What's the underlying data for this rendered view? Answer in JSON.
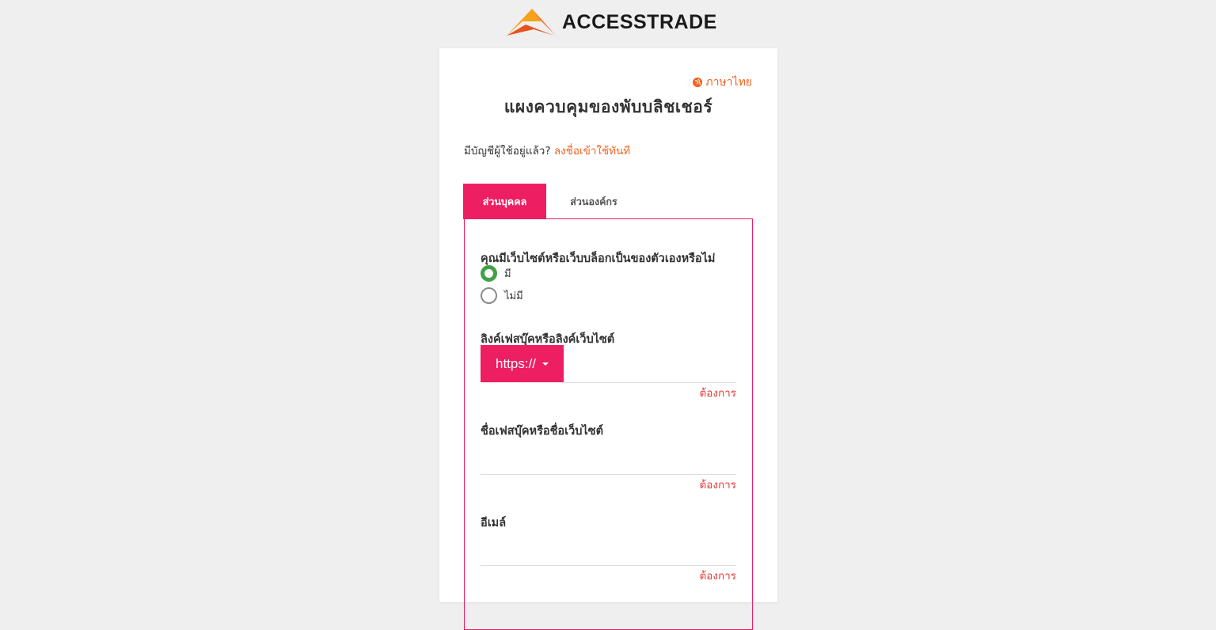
{
  "brand": {
    "name": "ACCESSTRADE",
    "colors": {
      "primary": "#ed1e62",
      "accent": "#f26522",
      "radio": "#43a047"
    }
  },
  "lang": {
    "icon": "globe-icon",
    "label": "ภาษาไทย"
  },
  "title": "แผงควบคุมของพับบลิชเชอร์",
  "login": {
    "prompt": "มีบัญชีผู้ใช้อยู่แล้ว?",
    "link": "ลงชื่อเข้าใช้ทันที"
  },
  "tabs": [
    {
      "label": "ส่วนบุคคล",
      "active": true
    },
    {
      "label": "ส่วนองค์กร",
      "active": false
    }
  ],
  "form": {
    "website_question": "คุณมีเว็บไซต์หรือเว็บบล็อกเป็นของตัวเองหรือไม่",
    "radio_yes": "มี",
    "radio_no": "ไม่มี",
    "link_label": "ลิงค์เฟสบุ๊คหรือลิงค์เว็บไซต์",
    "prefix": "https://",
    "name_label": "ชื่อเฟสบุ๊คหรือชื่อเว็บไซต์",
    "email_label": "อีเมล์",
    "required": "ต้องการ"
  }
}
